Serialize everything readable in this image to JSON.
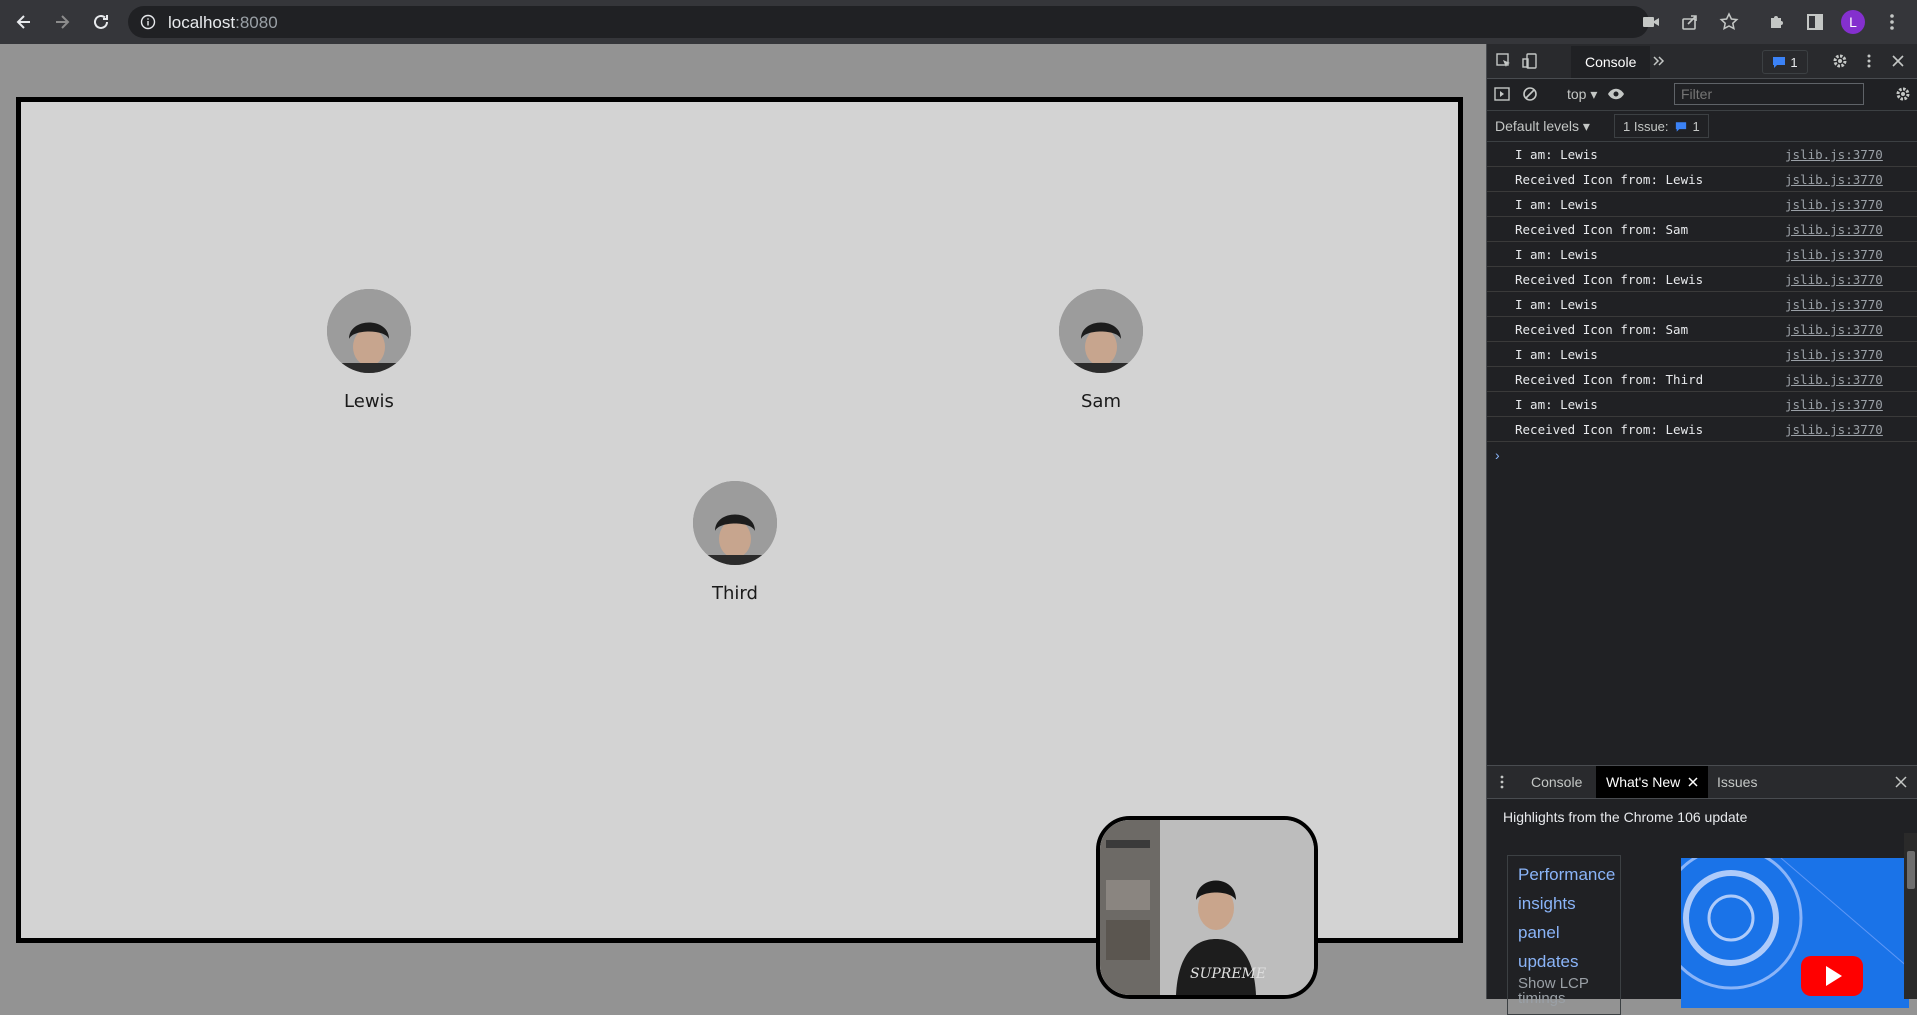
{
  "browser": {
    "url_host": "localhost",
    "url_port": ":8080",
    "profile_initial": "L",
    "icons": [
      "back-icon",
      "forward-icon",
      "reload-icon",
      "info-icon",
      "camera-icon",
      "share-icon",
      "star-icon",
      "extensions-icon",
      "sidepanel-icon",
      "profile-avatar",
      "menu-icon"
    ]
  },
  "page": {
    "participants": [
      {
        "name": "Lewis"
      },
      {
        "name": "Sam"
      },
      {
        "name": "Third"
      }
    ]
  },
  "devtools": {
    "tab_console": "Console",
    "issues_count": "1",
    "context": "top",
    "filter_placeholder": "Filter",
    "default_levels": "Default levels",
    "issue_label": "1 Issue:",
    "issue_count": "1",
    "logs": [
      {
        "msg": "I am: Lewis",
        "src": "jslib.js:3770"
      },
      {
        "msg": "Received Icon from: Lewis",
        "src": "jslib.js:3770"
      },
      {
        "msg": "I am: Lewis",
        "src": "jslib.js:3770"
      },
      {
        "msg": "Received Icon from: Sam",
        "src": "jslib.js:3770"
      },
      {
        "msg": "I am: Lewis",
        "src": "jslib.js:3770"
      },
      {
        "msg": "Received Icon from: Lewis",
        "src": "jslib.js:3770"
      },
      {
        "msg": "I am: Lewis",
        "src": "jslib.js:3770"
      },
      {
        "msg": "Received Icon from: Sam",
        "src": "jslib.js:3770"
      },
      {
        "msg": "I am: Lewis",
        "src": "jslib.js:3770"
      },
      {
        "msg": "Received Icon from: Third",
        "src": "jslib.js:3770"
      },
      {
        "msg": "I am: Lewis",
        "src": "jslib.js:3770"
      },
      {
        "msg": "Received Icon from: Lewis",
        "src": "jslib.js:3770"
      }
    ],
    "prompt": "›",
    "drawer": {
      "tabs": [
        "Console",
        "What's New",
        "Issues"
      ],
      "highlights": "Highlights from the Chrome 106 update",
      "card_title_lines": [
        "Performance",
        "insights",
        "panel",
        "updates"
      ],
      "card_sub_lines": [
        "Show LCP",
        "timings"
      ]
    }
  },
  "colors": {
    "page_bg": "#d3d3d3",
    "devtools_bg": "#202124",
    "link_blue": "#8ab4f8",
    "profile": "#8430ce"
  }
}
